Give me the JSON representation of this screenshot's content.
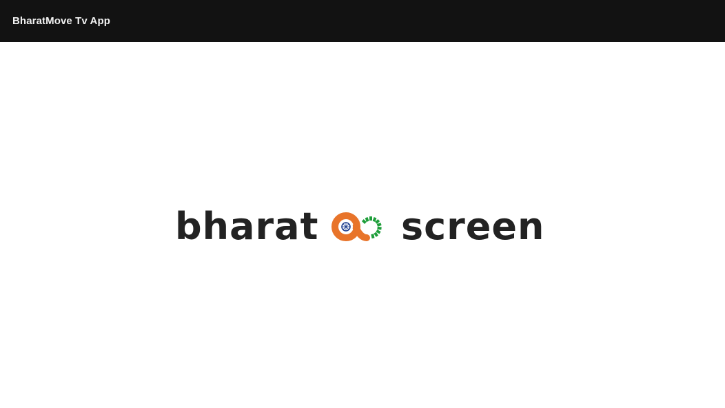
{
  "window": {
    "title": "BharatMove Tv App"
  },
  "logo": {
    "word_left": "bharat",
    "word_right": "screen",
    "mark_icon": "infinity-chakra-icon",
    "colors": {
      "text": "#222222",
      "saffron": "#E8742A",
      "green": "#1E9E3A",
      "chakra": "#1F3F8F"
    }
  },
  "colors": {
    "titlebar_bg": "#121212",
    "titlebar_text": "#f2f2f2",
    "background": "#ffffff"
  }
}
